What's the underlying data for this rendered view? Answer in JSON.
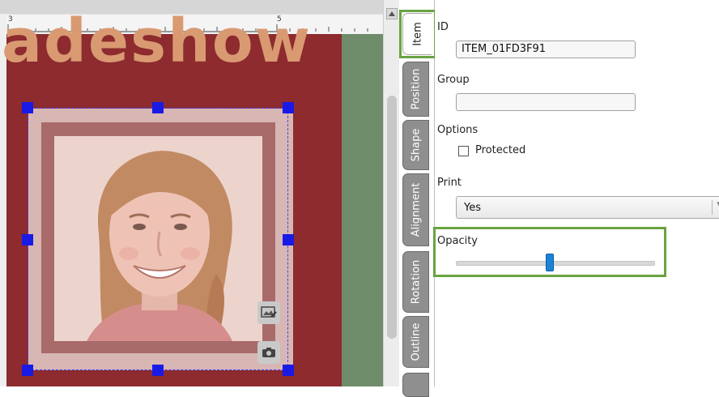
{
  "ruler": {
    "marks": [
      "3",
      "5"
    ]
  },
  "slide": {
    "title_text": "adeshow"
  },
  "tabs": [
    {
      "label": "Item",
      "active": true
    },
    {
      "label": "Position",
      "active": false
    },
    {
      "label": "Shape",
      "active": false
    },
    {
      "label": "Alignment",
      "active": false
    },
    {
      "label": "Rotation",
      "active": false
    },
    {
      "label": "Outline",
      "active": false
    }
  ],
  "panel": {
    "id_label": "ID",
    "id_value": "ITEM_01FD3F91",
    "group_label": "Group",
    "group_value": "",
    "options_label": "Options",
    "protected_label": "Protected",
    "protected_checked": false,
    "print_label": "Print",
    "print_value": "Yes",
    "opacity_label": "Opacity",
    "opacity_level": 0.47
  },
  "icons": {
    "replace_image": "image-edit-icon",
    "camera": "camera-icon",
    "scroll_up": "arrow-up-icon"
  },
  "colors": {
    "highlight": "#6aa340",
    "selection_handle": "#1a1ae6",
    "slider_handle": "#1b82d8",
    "slide_background": "#8d2b2f"
  }
}
